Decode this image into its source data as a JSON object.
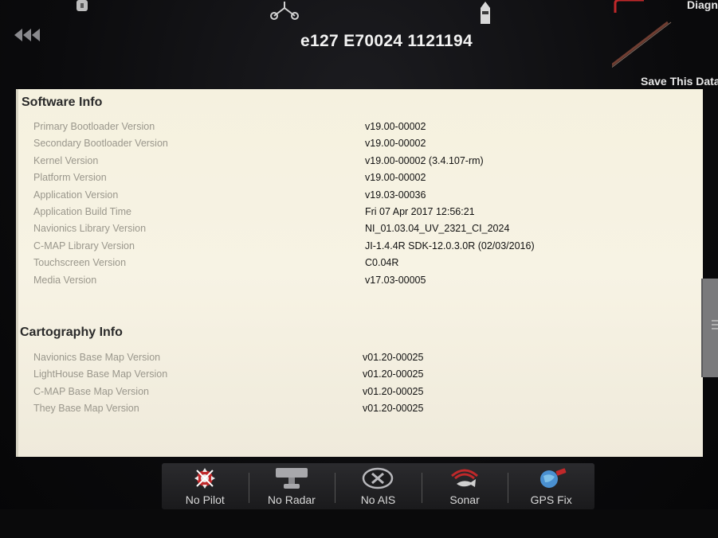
{
  "header": {
    "title": "e127 E70024 1121194",
    "diag_label": "Diagn",
    "save_label": "Save This Data"
  },
  "software": {
    "title": "Software Info",
    "rows": [
      {
        "label": "Primary Bootloader Version",
        "value": "v19.00-00002"
      },
      {
        "label": "Secondary Bootloader Version",
        "value": "v19.00-00002"
      },
      {
        "label": "Kernel Version",
        "value": "v19.00-00002 (3.4.107-rm)"
      },
      {
        "label": "Platform Version",
        "value": "v19.00-00002"
      },
      {
        "label": "Application Version",
        "value": "v19.03-00036"
      },
      {
        "label": "Application Build Time",
        "value": "Fri 07 Apr 2017 12:56:21"
      },
      {
        "label": "Navionics Library Version",
        "value": "NI_01.03.04_UV_2321_CI_2024"
      },
      {
        "label": "C-MAP Library Version",
        "value": "JI-1.4.4R SDK-12.0.3.0R (02/03/2016)"
      },
      {
        "label": "Touchscreen Version",
        "value": "C0.04R"
      },
      {
        "label": "Media Version",
        "value": "v17.03-00005"
      }
    ]
  },
  "cartography": {
    "title": "Cartography Info",
    "rows": [
      {
        "label": "Navionics Base Map Version",
        "value": "v01.20-00025"
      },
      {
        "label": "LightHouse Base Map Version",
        "value": "v01.20-00025"
      },
      {
        "label": "C-MAP Base Map Version",
        "value": "v01.20-00025"
      },
      {
        "label": "They Base Map Version",
        "value": "v01.20-00025"
      }
    ]
  },
  "statusbar": {
    "items": [
      {
        "label": "No Pilot",
        "icon": "pilot-icon"
      },
      {
        "label": "No Radar",
        "icon": "radar-icon"
      },
      {
        "label": "No AIS",
        "icon": "ais-icon"
      },
      {
        "label": "Sonar",
        "icon": "sonar-icon"
      },
      {
        "label": "GPS Fix",
        "icon": "gps-icon"
      }
    ]
  },
  "colors": {
    "panel_bg": "#f5f1df",
    "accent_red": "#c0282a",
    "label_gray": "#9a978c"
  }
}
